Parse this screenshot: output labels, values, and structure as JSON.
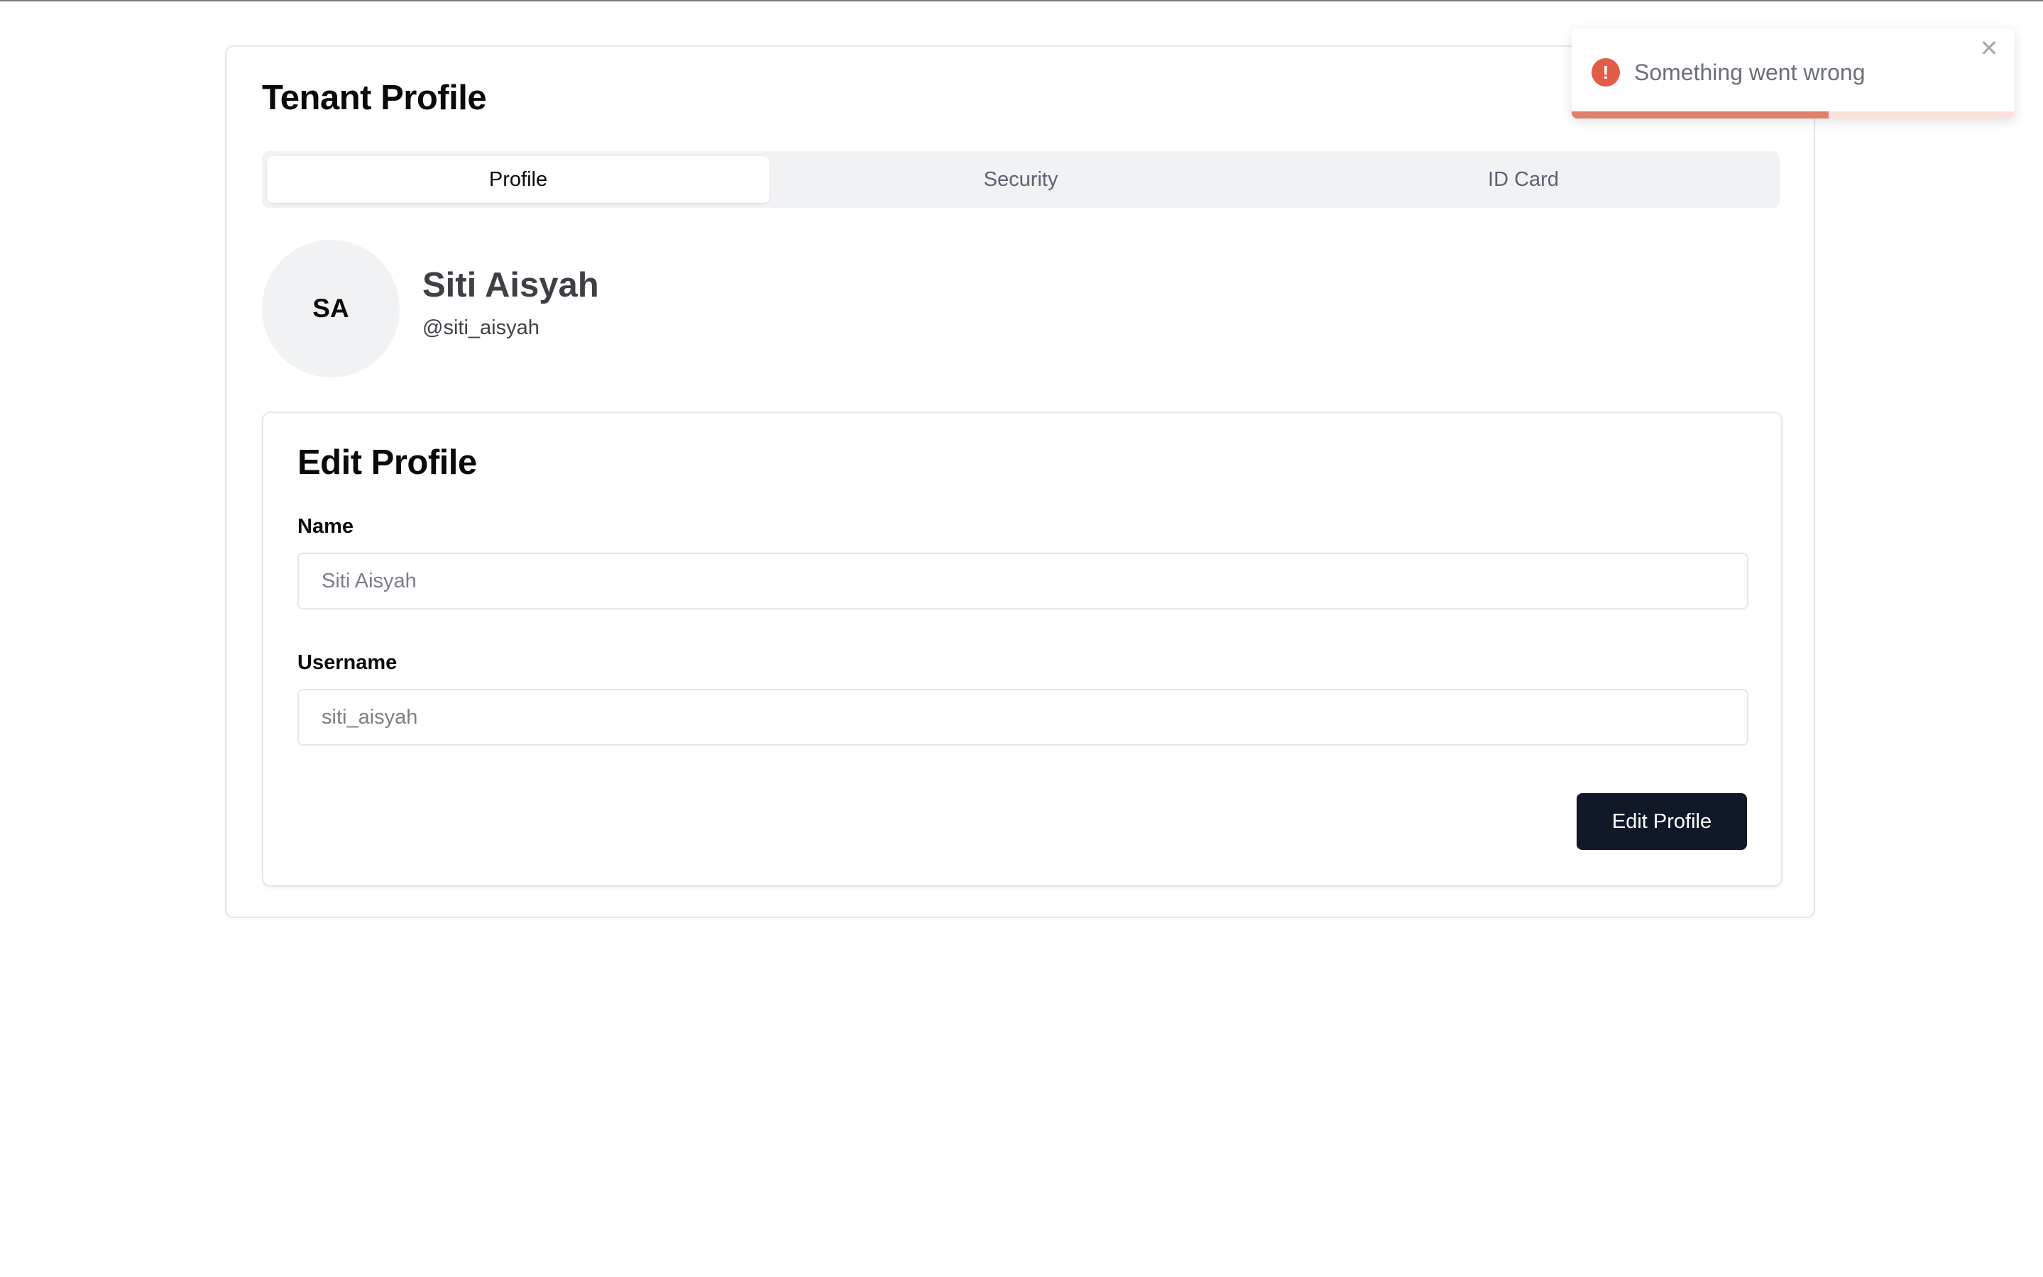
{
  "page": {
    "title": "Tenant Profile"
  },
  "tabs": [
    {
      "label": "Profile",
      "active": true
    },
    {
      "label": "Security",
      "active": false
    },
    {
      "label": "ID Card",
      "active": false
    }
  ],
  "profile": {
    "initials": "SA",
    "name": "Siti Aisyah",
    "handle": "@siti_aisyah"
  },
  "edit_form": {
    "title": "Edit Profile",
    "name_label": "Name",
    "name_placeholder": "Siti Aisyah",
    "name_value": "",
    "username_label": "Username",
    "username_placeholder": "siti_aisyah",
    "username_value": "",
    "submit_label": "Edit Profile"
  },
  "toast": {
    "type": "error",
    "icon": "exclamation-circle-icon",
    "icon_glyph": "!",
    "message": "Something went wrong",
    "close_glyph": "✕",
    "progress_fraction": 0.58
  },
  "colors": {
    "primary_button": "#111827",
    "error": "#e25c4a",
    "progress": "#e0806f"
  }
}
